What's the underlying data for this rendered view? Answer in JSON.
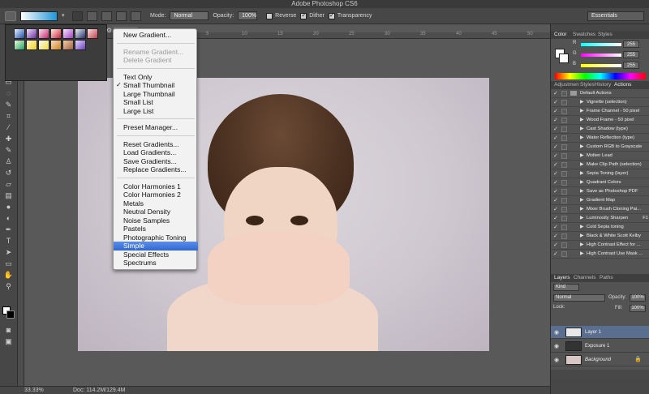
{
  "app": {
    "title": "Adobe Photoshop CS6"
  },
  "options_bar": {
    "mode_label": "Mode:",
    "mode_value": "Normal",
    "opacity_label": "Opacity:",
    "opacity_value": "100%",
    "reverse_label": "Reverse",
    "dither_label": "Dither",
    "transparency_label": "Transparency",
    "workspace": "Essentials"
  },
  "gradient_presets": {
    "swatches": [
      [
        "#e8f0ff",
        "#1d4fa8"
      ],
      [
        "#f0e0ff",
        "#6a2c9c"
      ],
      [
        "#ffe0f0",
        "#c02a6a"
      ],
      [
        "#fff0e0",
        "#d02040"
      ],
      [
        "#f8e8ff",
        "#a040c0"
      ],
      [
        "#f0f0f0",
        "#203070"
      ],
      [
        "#f8e0e0",
        "#c04050"
      ],
      [
        "#f0f8e0",
        "#20a060"
      ],
      [
        "#fff8d0",
        "#f0d020"
      ],
      [
        "#f8f8f8",
        "#f0e040"
      ],
      [
        "#f8e0c0",
        "#d08020"
      ],
      [
        "#f0d0b0",
        "#a06040"
      ],
      [
        "#e0d8ff",
        "#7040c0"
      ]
    ]
  },
  "gradient_menu": {
    "items": [
      {
        "label": "New Gradient...",
        "enabled": true
      },
      {
        "label": "Rename Gradient...",
        "enabled": false
      },
      {
        "label": "Delete Gradient",
        "enabled": false
      },
      {
        "label": "Text Only",
        "enabled": true
      },
      {
        "label": "Small Thumbnail",
        "enabled": true,
        "checked": true
      },
      {
        "label": "Large Thumbnail",
        "enabled": true
      },
      {
        "label": "Small List",
        "enabled": true
      },
      {
        "label": "Large List",
        "enabled": true
      },
      {
        "label": "Preset Manager...",
        "enabled": true
      },
      {
        "label": "Reset Gradients...",
        "enabled": true
      },
      {
        "label": "Load Gradients...",
        "enabled": true
      },
      {
        "label": "Save Gradients...",
        "enabled": true
      },
      {
        "label": "Replace Gradients...",
        "enabled": true
      },
      {
        "label": "Color Harmonies 1",
        "enabled": true
      },
      {
        "label": "Color Harmonies 2",
        "enabled": true
      },
      {
        "label": "Metals",
        "enabled": true
      },
      {
        "label": "Neutral Density",
        "enabled": true
      },
      {
        "label": "Noise Samples",
        "enabled": true
      },
      {
        "label": "Pastels",
        "enabled": true
      },
      {
        "label": "Photographic Toning",
        "enabled": true
      },
      {
        "label": "Simple",
        "enabled": true,
        "selected": true
      },
      {
        "label": "Special Effects",
        "enabled": true
      },
      {
        "label": "Spectrums",
        "enabled": true
      }
    ]
  },
  "color_panel": {
    "tabs": [
      "Color",
      "Swatches",
      "Styles"
    ],
    "channels": [
      {
        "name": "R",
        "value": "255"
      },
      {
        "name": "G",
        "value": "255"
      },
      {
        "name": "B",
        "value": "255"
      }
    ]
  },
  "actions_panel": {
    "tabs": [
      "Adjustmen",
      "Styles",
      "History",
      "Actions"
    ],
    "group_name": "Default Actions",
    "actions": [
      {
        "name": "Vignette (selection)",
        "key": ""
      },
      {
        "name": "Frame Channel - 50 pixel",
        "key": ""
      },
      {
        "name": "Wood Frame - 50 pixel",
        "key": ""
      },
      {
        "name": "Cast Shadow (type)",
        "key": ""
      },
      {
        "name": "Water Reflection (type)",
        "key": ""
      },
      {
        "name": "Custom RGB to Grayscale",
        "key": ""
      },
      {
        "name": "Molten Lead",
        "key": ""
      },
      {
        "name": "Make Clip Path (selection)",
        "key": ""
      },
      {
        "name": "Sepia Toning (layer)",
        "key": ""
      },
      {
        "name": "Quadrant Colors",
        "key": ""
      },
      {
        "name": "Save as Photoshop PDF",
        "key": ""
      },
      {
        "name": "Gradient Map",
        "key": ""
      },
      {
        "name": "Mixer Brush Cloning Pai...",
        "key": ""
      },
      {
        "name": "Luminosity Sharpen",
        "key": "F1"
      },
      {
        "name": "Cold Sepia toning",
        "key": ""
      },
      {
        "name": "Black & White Scott Kelby",
        "key": ""
      },
      {
        "name": "High Contrast Effect for ...",
        "key": ""
      },
      {
        "name": "High Contrast Use Mask ...",
        "key": ""
      }
    ]
  },
  "layers_panel": {
    "tabs": [
      "Layers",
      "Channels",
      "Paths"
    ],
    "kind_label": "Kind",
    "blend_mode": "Normal",
    "opacity_label": "Opacity:",
    "opacity_value": "100%",
    "lock_label": "Lock:",
    "fill_label": "Fill:",
    "fill_value": "100%",
    "layers": [
      {
        "name": "Layer 1",
        "selected": true
      },
      {
        "name": "Exposure 1",
        "selected": false
      },
      {
        "name": "Background",
        "selected": false
      }
    ]
  },
  "status_bar": {
    "zoom": "33.33%",
    "doc_info": "Doc: 114.2M/129.4M"
  },
  "ruler": {
    "marks": [
      "5",
      "10",
      "15",
      "20",
      "25",
      "30",
      "35",
      "40",
      "45",
      "50"
    ]
  }
}
